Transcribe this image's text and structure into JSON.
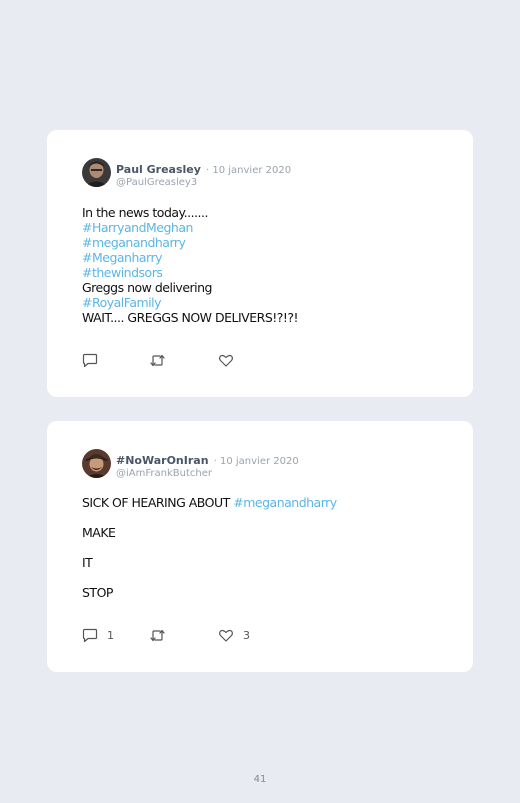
{
  "tweets": [
    {
      "name": "Paul Greasley",
      "date": "· 10 janvier 2020",
      "handle": "@PaulGreasley3",
      "lines": [
        {
          "text": "In the news today.......",
          "tag": false
        },
        {
          "text": "#HarryandMeghan",
          "tag": true
        },
        {
          "text": "#meganandharry",
          "tag": true
        },
        {
          "text": "#Meganharry",
          "tag": true
        },
        {
          "text": "#thewindsors",
          "tag": true
        },
        {
          "text": "Greggs now delivering",
          "tag": false
        },
        {
          "text": "#RoyalFamily",
          "tag": true
        },
        {
          "text": "WAIT.... GREGGS NOW DELIVERS!?!?!",
          "tag": false
        }
      ],
      "reply_icon": "comment-icon",
      "retweet_icon": "retweet-icon",
      "like_icon": "heart-icon"
    },
    {
      "name": "#NoWarOnIran",
      "date": "· 10 janvier 2020",
      "handle": "@iAmFrankButcher",
      "paragraphs": [
        {
          "prefix": "SICK OF HEARING ABOUT ",
          "tag": "#meganandharry"
        },
        {
          "prefix": "MAKE",
          "tag": ""
        },
        {
          "prefix": "IT",
          "tag": ""
        },
        {
          "prefix": "STOP",
          "tag": ""
        }
      ],
      "reply_count": "1",
      "like_count": "3",
      "reply_icon": "comment-icon",
      "retweet_icon": "retweet-icon",
      "like_icon": "heart-icon"
    }
  ],
  "page_number": "41",
  "colors": {
    "background": "#e8ebf2",
    "card": "#ffffff",
    "hashtag": "#5bb6e6",
    "name": "#4a5566",
    "muted": "#9aa3ad"
  }
}
